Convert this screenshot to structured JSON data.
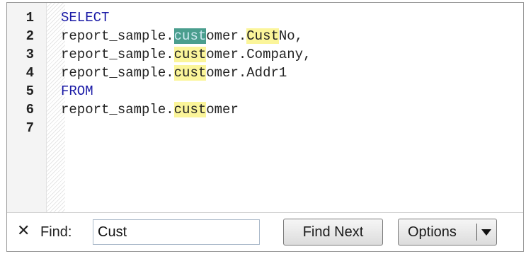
{
  "editor": {
    "lines": [
      {
        "number": "1",
        "segments": [
          {
            "text": "SELECT",
            "style": "kw"
          }
        ]
      },
      {
        "number": "2",
        "segments": [
          {
            "text": "report_sample.",
            "style": ""
          },
          {
            "text": "cust",
            "style": "hl-cur"
          },
          {
            "text": "omer.",
            "style": ""
          },
          {
            "text": "Cust",
            "style": "hl"
          },
          {
            "text": "No,",
            "style": ""
          }
        ]
      },
      {
        "number": "3",
        "segments": [
          {
            "text": "report_sample.",
            "style": ""
          },
          {
            "text": "cust",
            "style": "hl"
          },
          {
            "text": "omer.Company,",
            "style": ""
          }
        ]
      },
      {
        "number": "4",
        "segments": [
          {
            "text": "report_sample.",
            "style": ""
          },
          {
            "text": "cust",
            "style": "hl"
          },
          {
            "text": "omer.Addr1",
            "style": ""
          }
        ]
      },
      {
        "number": "5",
        "segments": [
          {
            "text": "FROM",
            "style": "kw"
          }
        ]
      },
      {
        "number": "6",
        "segments": [
          {
            "text": "report_sample.",
            "style": ""
          },
          {
            "text": "cust",
            "style": "hl"
          },
          {
            "text": "omer",
            "style": ""
          }
        ]
      },
      {
        "number": "7",
        "segments": []
      }
    ]
  },
  "findbar": {
    "close_glyph": "✕",
    "find_label": "Find:",
    "find_value": "Cust",
    "find_next_label": "Find Next",
    "options_label": "Options"
  },
  "colors": {
    "keyword": "#1a1aa6",
    "match_highlight": "#fbf59a",
    "current_match": "#4a9e8e"
  }
}
